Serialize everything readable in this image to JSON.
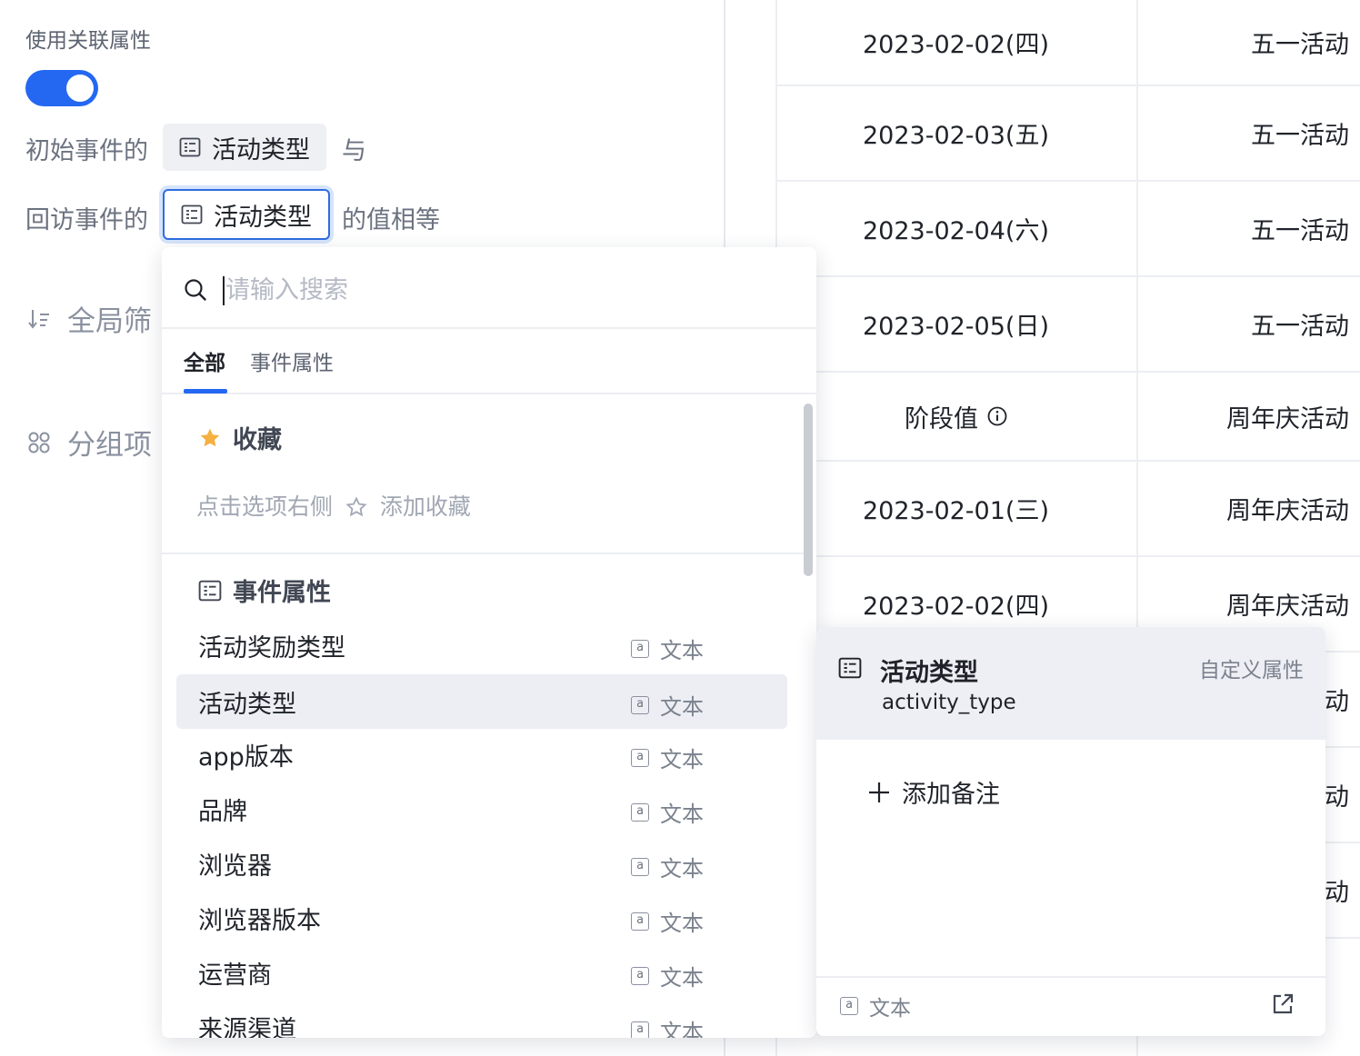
{
  "colors": {
    "accent": "#2468f2",
    "hover_bg": "#eceef3",
    "star": "#f5b041"
  },
  "config": {
    "title": "使用关联属性",
    "toggle_on": true,
    "initial_prefix": "初始事件的",
    "initial_chip": "活动类型",
    "initial_suffix": "与",
    "return_prefix": "回访事件的",
    "return_chip": "活动类型",
    "return_suffix": "的值相等",
    "global_filter": "全局筛",
    "group_by": "分组项"
  },
  "table": {
    "rows": [
      {
        "date": "2023-02-02(四)",
        "activity": "五一活动"
      },
      {
        "date": "2023-02-03(五)",
        "activity": "五一活动"
      },
      {
        "date": "2023-02-04(六)",
        "activity": "五一活动"
      },
      {
        "date": "2023-02-05(日)",
        "activity": "五一活动"
      },
      {
        "date": "阶段值",
        "activity": "周年庆活动"
      },
      {
        "date": "2023-02-01(三)",
        "activity": "周年庆活动"
      },
      {
        "date": "2023-02-02(四)",
        "activity": "周年庆活动"
      },
      {
        "date": "",
        "activity": "动"
      },
      {
        "date": "",
        "activity": "动"
      },
      {
        "date": "",
        "activity": "动"
      }
    ]
  },
  "dropdown": {
    "search_placeholder": "请输入搜索",
    "tabs": [
      "全部",
      "事件属性"
    ],
    "favorites_title": "收藏",
    "favorites_hint_left": "点击选项右侧",
    "favorites_hint_right": "添加收藏",
    "group_title": "事件属性",
    "options": [
      {
        "name": "活动奖励类型",
        "type": "文本"
      },
      {
        "name": "活动类型",
        "type": "文本"
      },
      {
        "name": "app版本",
        "type": "文本"
      },
      {
        "name": "品牌",
        "type": "文本"
      },
      {
        "name": "浏览器",
        "type": "文本"
      },
      {
        "name": "浏览器版本",
        "type": "文本"
      },
      {
        "name": "运营商",
        "type": "文本"
      },
      {
        "name": "来源渠道",
        "type": "文本"
      }
    ]
  },
  "detail": {
    "name": "活动类型",
    "tag": "自定义属性",
    "key": "activity_type",
    "add_note": "添加备注",
    "type": "文本"
  }
}
